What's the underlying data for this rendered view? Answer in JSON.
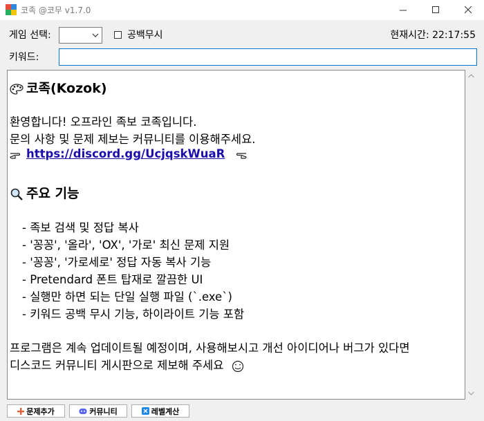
{
  "window": {
    "title": "코족 @코무 v1.7.0",
    "icon": "app-grid-icon",
    "colors": {
      "accent": "#0078d7",
      "link": "#1a0dab"
    }
  },
  "toolbar": {
    "game_label": "게임 선택:",
    "game_value": "",
    "ignore_space_label": "공백무시",
    "ignore_space_checked": false,
    "clock_label": "현재시간: 22:17:55"
  },
  "keyword": {
    "label": "키워드:",
    "value": ""
  },
  "content": {
    "heading1": "코족(Kozok)",
    "welcome": "환영합니다! 오프라인 족보 코족입니다.",
    "inquiry": "문의 사항 및 문제 제보는 커뮤니티를 이용해주세요.",
    "link": "https://discord.gg/UcjqskWuaR",
    "heading2": "주요 기능",
    "features": [
      "- 족보 검색 및 정답 복사",
      "- '꽁꽁', '올라', 'OX', '가로' 최신 문제 지원",
      "- '꽁꽁', '가로세로' 정답 자동 복사 기능",
      "- Pretendard 폰트 탑재로 깔끔한 UI",
      "- 실행만 하면 되는 단일 실행 파일 (`.exe`)",
      "- 키워드 공백 무시 기능, 하이라이트 기능 포함"
    ],
    "outro1": "프로그램은 계속 업데이트될 예정이며, 사용해보시고 개선 아이디어나 버그가 있다면",
    "outro2": "디스코드 커뮤니티 게시판으로 제보해 주세요"
  },
  "buttons": {
    "add_problem": "문제추가",
    "community": "커뮤니티",
    "level_calc": "레벨계산"
  }
}
